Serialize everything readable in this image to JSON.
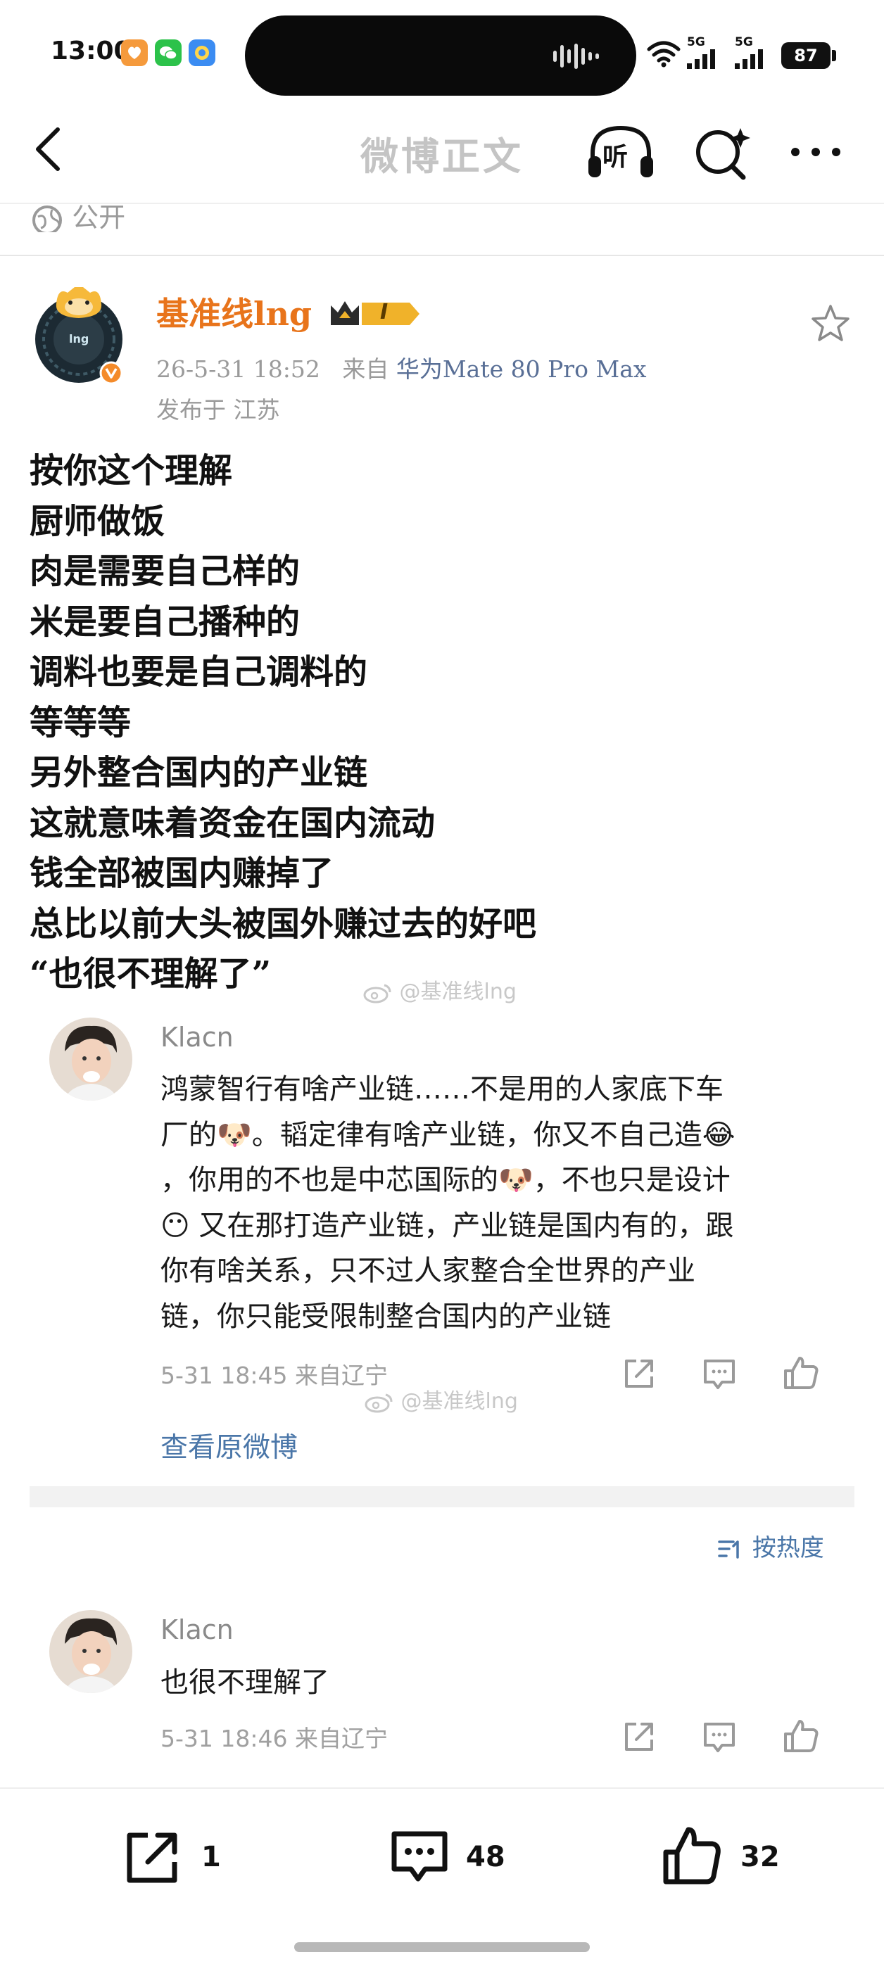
{
  "status_bar": {
    "time": "13:00",
    "app_icons": [
      "weibo-orange-icon",
      "wechat-icon",
      "browser-icon"
    ],
    "network_1": "5G",
    "network_2": "5G",
    "battery": "87"
  },
  "header": {
    "title": "微博正文",
    "listen_label": "听"
  },
  "visibility": "公开",
  "post": {
    "author": "基准线lng",
    "avatar_text": "lng",
    "vip_level": "I",
    "timestamp": "26-5-31 18:52",
    "source_prefix": "来自",
    "device": "华为Mate 80 Pro Max",
    "location": "发布于 江苏",
    "lines": [
      "按你这个理解",
      "厨师做饭",
      "肉是需要自己样的",
      "米是要自己播种的",
      "调料也要是自己调料的",
      "等等等",
      "另外整合国内的产业链",
      "这就意味着资金在国内流动",
      "钱全部被国内赚掉了",
      "总比以前大头被国外赚过去的好吧",
      "“也很不理解了”"
    ],
    "watermark": "@基准线lng"
  },
  "quoted_comment": {
    "author": "Klacn",
    "lines": [
      "鸿蒙智行有啥产业链……不是用的人家底下车",
      "厂的🐶。韬定律有啥产业链，你又不自己造😂",
      "，你用的不也是中芯国际的🐶，不也只是设计",
      "😶 又在那打造产业链，产业链是国内有的，跟",
      "你有啥关系，只不过人家整合全世界的产业",
      "链，你只能受限制整合国内的产业链"
    ],
    "meta": "5-31 18:45 来自辽宁",
    "watermark": "@基准线lng",
    "view_original": "查看原微博"
  },
  "sort_label": "按热度",
  "reply": {
    "author": "Klacn",
    "text": "也很不理解了",
    "meta": "5-31 18:46 来自辽宁"
  },
  "bottom_bar": {
    "reposts": "1",
    "comments": "48",
    "likes": "32"
  },
  "colors": {
    "author_orange": "#e8741b",
    "link_blue": "#4a76a8",
    "device_blue": "#596f96",
    "vip_gold": "#f0b22a"
  }
}
